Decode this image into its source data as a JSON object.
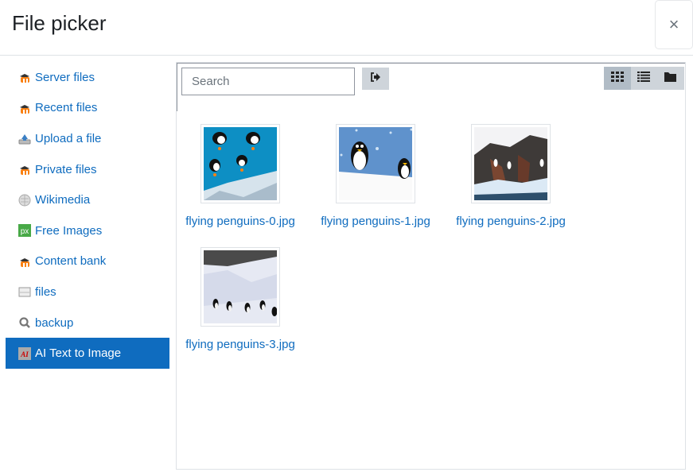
{
  "dialog": {
    "title": "File picker",
    "close_label": "×"
  },
  "sidebar": {
    "items": [
      {
        "label": "Server files",
        "icon": "moodle-icon",
        "active": false
      },
      {
        "label": "Recent files",
        "icon": "moodle-icon",
        "active": false
      },
      {
        "label": "Upload a file",
        "icon": "upload-icon",
        "active": false
      },
      {
        "label": "Private files",
        "icon": "moodle-icon",
        "active": false
      },
      {
        "label": "Wikimedia",
        "icon": "wikimedia-icon",
        "active": false
      },
      {
        "label": "Free Images",
        "icon": "pixabay-icon",
        "active": false
      },
      {
        "label": "Content bank",
        "icon": "moodle-icon",
        "active": false
      },
      {
        "label": "files",
        "icon": "filesystem-icon",
        "active": false
      },
      {
        "label": "backup",
        "icon": "search-icon",
        "active": false
      },
      {
        "label": "AI Text to Image",
        "icon": "ai-icon",
        "active": true
      }
    ]
  },
  "toolbar": {
    "search_placeholder": "Search",
    "search_value": "",
    "go_icon": "sign-in-icon",
    "views": [
      {
        "name": "icons-view",
        "icon": "grid-icon",
        "active": true
      },
      {
        "name": "list-view",
        "icon": "list-icon",
        "active": false
      },
      {
        "name": "tree-view",
        "icon": "folder-icon",
        "active": false
      }
    ]
  },
  "files": [
    {
      "name": "flying penguins-0.jpg"
    },
    {
      "name": "flying penguins-1.jpg"
    },
    {
      "name": "flying penguins-2.jpg"
    },
    {
      "name": "flying penguins-3.jpg"
    }
  ],
  "colors": {
    "accent": "#0f6cbf",
    "toolbar_button": "#ced4da",
    "active_view": "#b1bcc6"
  }
}
